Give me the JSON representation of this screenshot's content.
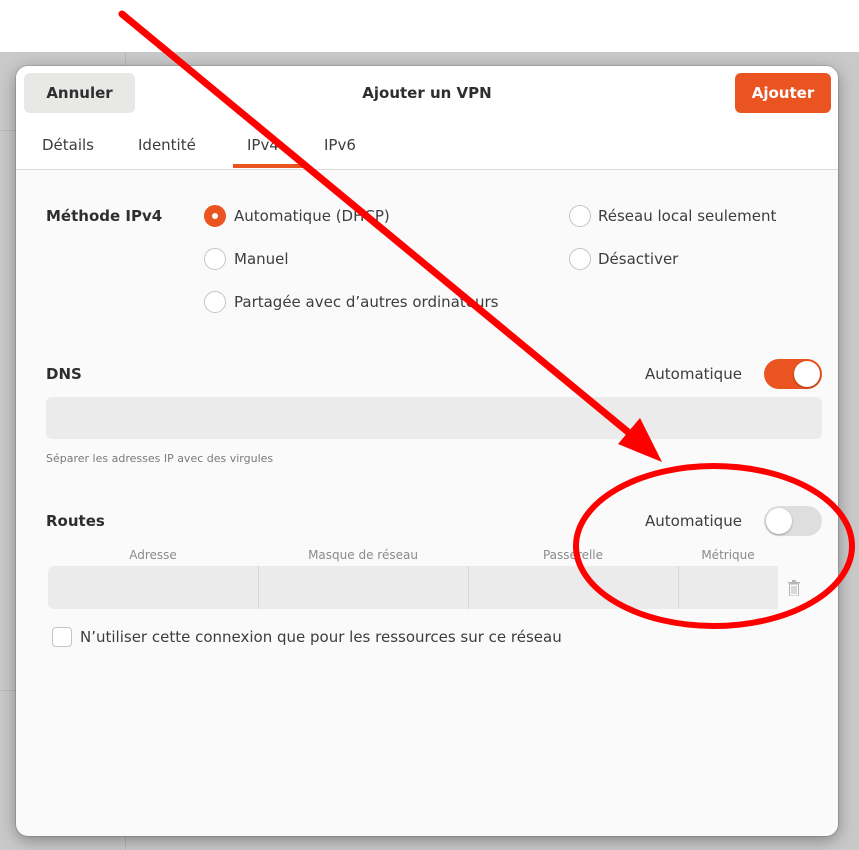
{
  "dialog": {
    "title": "Ajouter un VPN",
    "cancel_label": "Annuler",
    "add_label": "Ajouter"
  },
  "tabs": [
    {
      "label": "Détails"
    },
    {
      "label": "Identité"
    },
    {
      "label": "IPv4",
      "active": true
    },
    {
      "label": "IPv6"
    }
  ],
  "ipv4_method": {
    "label": "Méthode IPv4",
    "options": [
      {
        "label": "Automatique (DHCP)",
        "selected": true
      },
      {
        "label": "Réseau local seulement",
        "selected": false
      },
      {
        "label": "Manuel",
        "selected": false
      },
      {
        "label": "Désactiver",
        "selected": false
      },
      {
        "label": "Partagée avec d’autres ordinateurs",
        "selected": false
      }
    ]
  },
  "dns": {
    "label": "DNS",
    "auto_label": "Automatique",
    "auto_on": true,
    "value": "",
    "hint": "Séparer les adresses IP avec des virgules"
  },
  "routes": {
    "label": "Routes",
    "auto_label": "Automatique",
    "auto_on": false,
    "columns": [
      "Adresse",
      "Masque de réseau",
      "Passerelle",
      "Métrique"
    ]
  },
  "only_resources": {
    "label": "N’utiliser cette connexion que pour les ressources sur ce réseau",
    "checked": false
  },
  "colors": {
    "accent": "#e95420",
    "annotation": "#ff0000"
  },
  "icons": [
    "trash-icon",
    "annotation-arrow",
    "annotation-circle"
  ]
}
